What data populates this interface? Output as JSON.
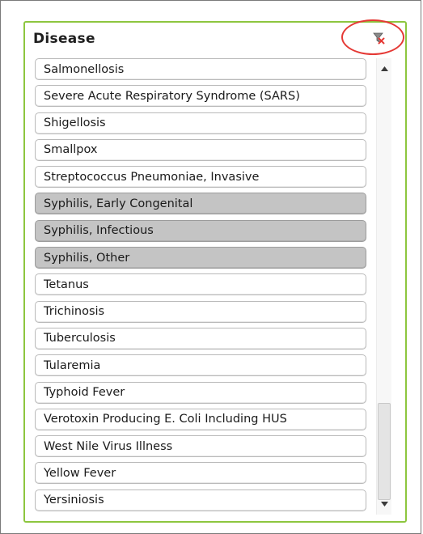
{
  "panel": {
    "title": "Disease",
    "clear_icon": "clear-filter-icon",
    "highlight_color": "#e53935",
    "border_color": "#8dc63f"
  },
  "list": {
    "items": [
      {
        "label": "Salmonellosis",
        "selected": false
      },
      {
        "label": "Severe Acute Respiratory Syndrome (SARS)",
        "selected": false
      },
      {
        "label": "Shigellosis",
        "selected": false
      },
      {
        "label": "Smallpox",
        "selected": false
      },
      {
        "label": "Streptococcus Pneumoniae, Invasive",
        "selected": false
      },
      {
        "label": "Syphilis, Early Congenital",
        "selected": true
      },
      {
        "label": "Syphilis, Infectious",
        "selected": true
      },
      {
        "label": "Syphilis, Other",
        "selected": true
      },
      {
        "label": "Tetanus",
        "selected": false
      },
      {
        "label": "Trichinosis",
        "selected": false
      },
      {
        "label": "Tuberculosis",
        "selected": false
      },
      {
        "label": "Tularemia",
        "selected": false
      },
      {
        "label": "Typhoid Fever",
        "selected": false
      },
      {
        "label": "Verotoxin Producing E. Coli Including HUS",
        "selected": false
      },
      {
        "label": "West Nile Virus Illness",
        "selected": false
      },
      {
        "label": "Yellow Fever",
        "selected": false
      },
      {
        "label": "Yersiniosis",
        "selected": false
      }
    ],
    "selected_color": "#c4c4c4"
  },
  "scrollbar": {
    "up_icon": "scroll-up-arrow-icon",
    "down_icon": "scroll-down-arrow-icon"
  }
}
